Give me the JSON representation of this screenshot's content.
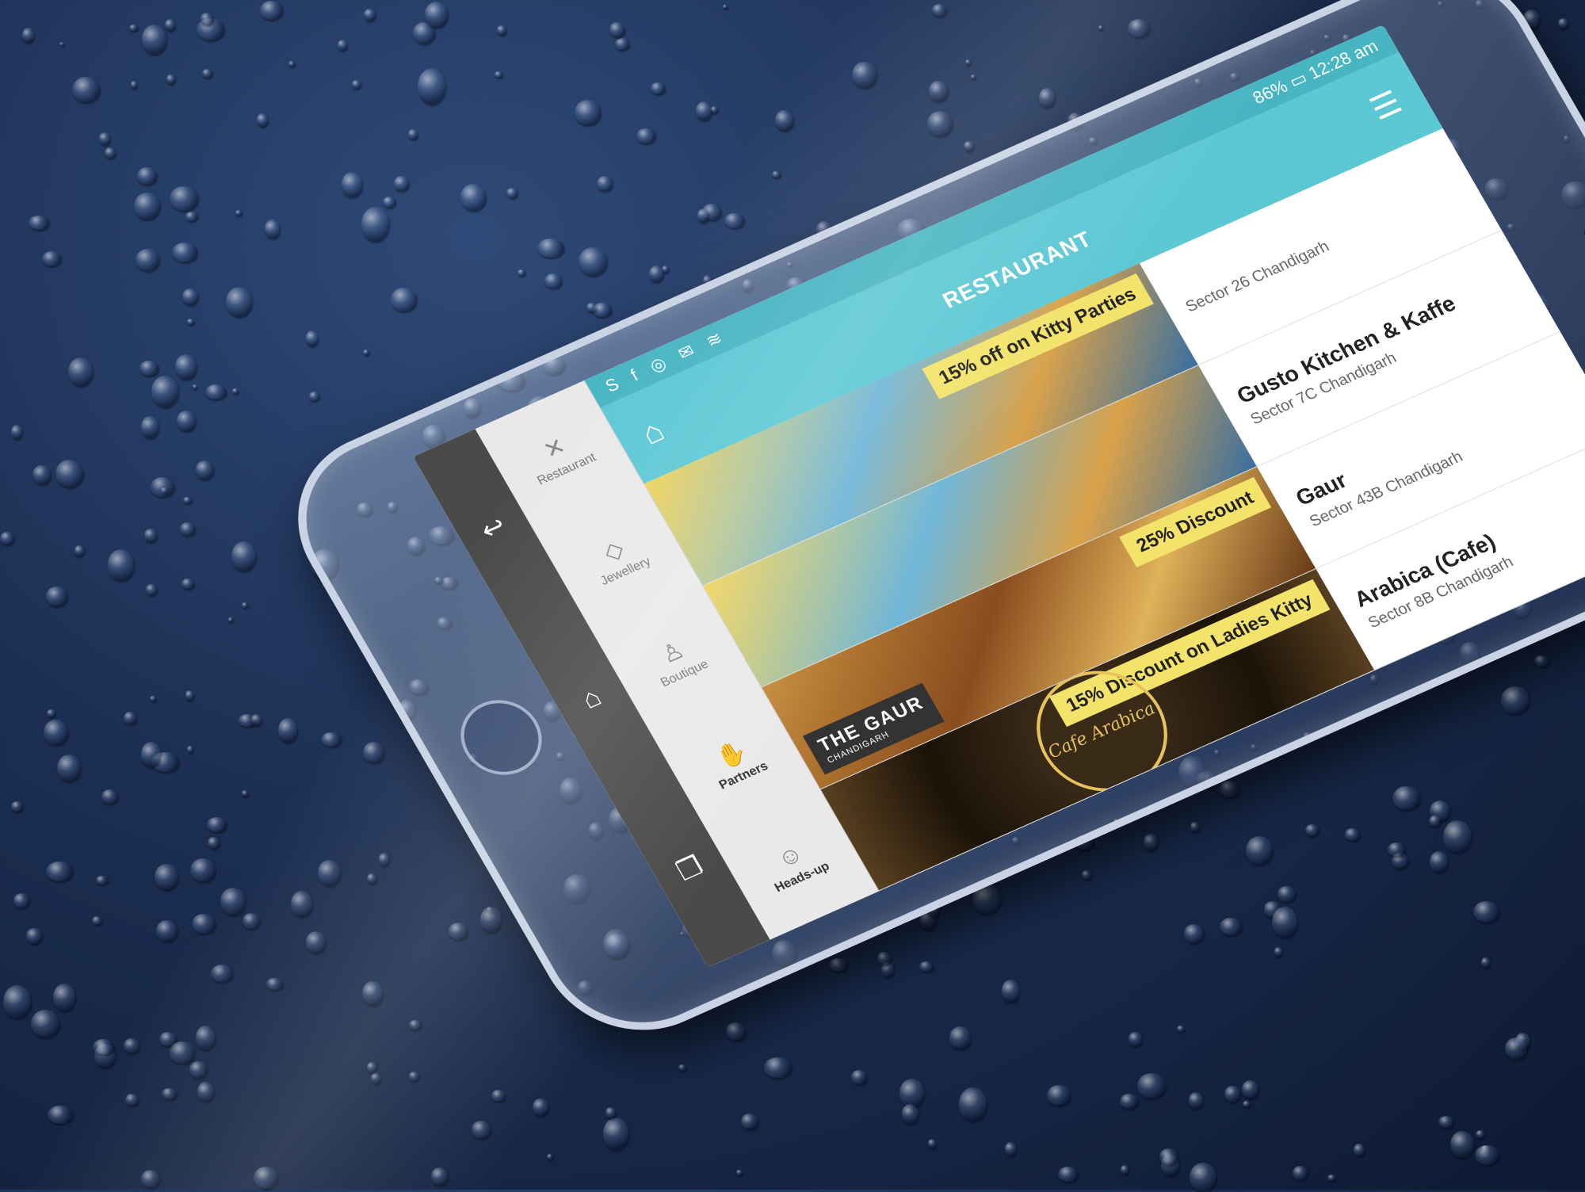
{
  "statusbar": {
    "battery": "86%",
    "time": "12:28",
    "ampm": "am",
    "icons": [
      "home-icon",
      "dots-icon",
      "skype-icon",
      "facebook-icon",
      "whatsapp-icon",
      "tablet-icon",
      "email-icon",
      "message-icon",
      "wifi-icon",
      "signal-icon",
      "battery-icon"
    ]
  },
  "appbar": {
    "title": "RESTAURANT",
    "home_icon": "home-icon",
    "menu_icon": "hamburger-menu-icon"
  },
  "restaurants": [
    {
      "name": "",
      "address": "Sector 26 Chandigarh",
      "offer": "15% off on Kitty Parties",
      "brand": ""
    },
    {
      "name": "Gusto Kitchen & Kaffe",
      "address": "Sector 7C Chandigarh",
      "offer": "",
      "brand": ""
    },
    {
      "name": "Gaur",
      "address": "Sector 43B Chandigarh",
      "offer": "25% Discount",
      "brand": "THE GAUR",
      "brand_sub": "CHANDIGARH"
    },
    {
      "name": "Arabica (Cafe)",
      "address": "Sector 8B Chandigarh",
      "offer": "15% Discount on Ladies Kitty",
      "brand": "Cafe Arabica"
    }
  ],
  "header_address": "Sector 26 Chandigarh",
  "tabs": [
    {
      "label": "Restaurant",
      "icon": "fork-knife-icon"
    },
    {
      "label": "Jewellery",
      "icon": "diamond-icon"
    },
    {
      "label": "Boutique",
      "icon": "dress-icon"
    },
    {
      "label": "Partners",
      "icon": "handshake-icon"
    },
    {
      "label": "Heads-up",
      "icon": "head-icon"
    }
  ],
  "navbar": {
    "back": "↩",
    "home": "⌂",
    "recents": "❐"
  },
  "colors": {
    "accent": "#5cc8d4",
    "status": "#48b5c2",
    "offer": "#f3e36b",
    "navbar": "#4a4a4a"
  }
}
